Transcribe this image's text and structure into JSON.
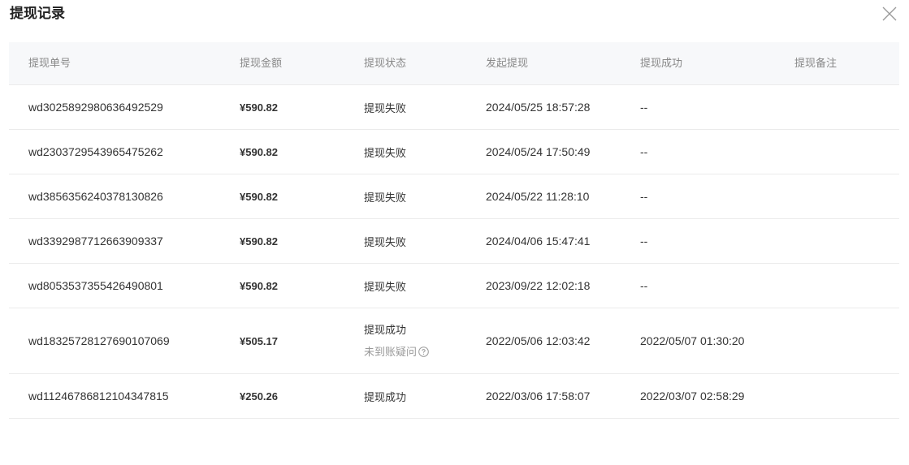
{
  "dialog": {
    "title": "提现记录",
    "close_icon": "close-icon"
  },
  "table": {
    "headers": {
      "order_no": "提现单号",
      "amount": "提现金额",
      "status": "提现状态",
      "initiated": "发起提现",
      "succeeded": "提现成功",
      "remark": "提现备注"
    },
    "rows": [
      {
        "order_no": "wd3025892980636492529",
        "amount": "¥590.82",
        "status": "提现失败",
        "initiated": "2024/05/25 18:57:28",
        "succeeded": "--",
        "remark": ""
      },
      {
        "order_no": "wd2303729543965475262",
        "amount": "¥590.82",
        "status": "提现失败",
        "initiated": "2024/05/24 17:50:49",
        "succeeded": "--",
        "remark": ""
      },
      {
        "order_no": "wd3856356240378130826",
        "amount": "¥590.82",
        "status": "提现失败",
        "initiated": "2024/05/22 11:28:10",
        "succeeded": "--",
        "remark": ""
      },
      {
        "order_no": "wd3392987712663909337",
        "amount": "¥590.82",
        "status": "提现失败",
        "initiated": "2024/04/06 15:47:41",
        "succeeded": "--",
        "remark": ""
      },
      {
        "order_no": "wd8053537355426490801",
        "amount": "¥590.82",
        "status": "提现失败",
        "initiated": "2023/09/22 12:02:18",
        "succeeded": "--",
        "remark": ""
      },
      {
        "order_no": "wd18325728127690107069",
        "amount": "¥505.17",
        "status": "提现成功",
        "status_sub": "未到账疑问",
        "status_sub_icon": "question-circle-icon",
        "initiated": "2022/05/06 12:03:42",
        "succeeded": "2022/05/07 01:30:20",
        "remark": ""
      },
      {
        "order_no": "wd11246786812104347815",
        "amount": "¥250.26",
        "status": "提现成功",
        "initiated": "2022/03/06 17:58:07",
        "succeeded": "2022/03/07 02:58:29",
        "remark": ""
      }
    ]
  },
  "colors": {
    "header_bg": "#f7f8fa",
    "divider": "#ebebeb",
    "text": "#333333",
    "muted": "#888888"
  }
}
